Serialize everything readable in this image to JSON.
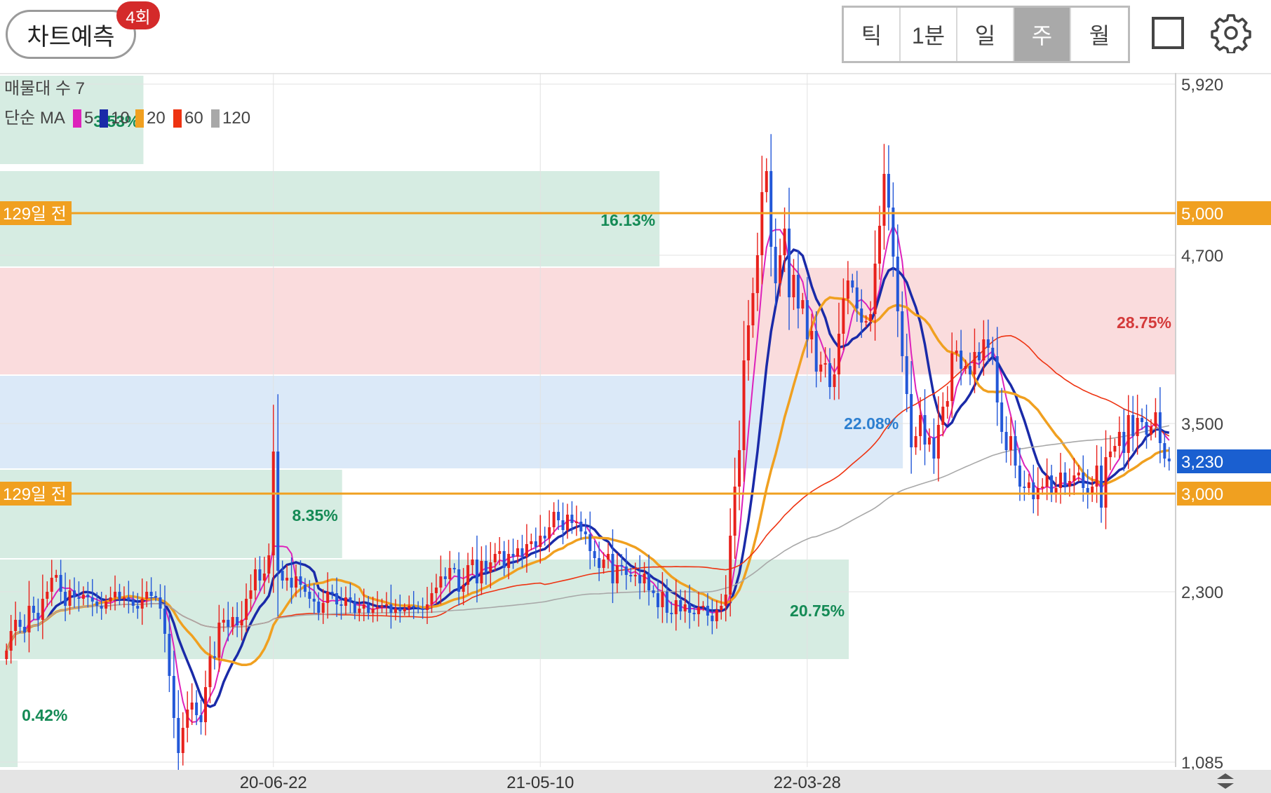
{
  "toolbar": {
    "predict_label": "차트예측",
    "predict_badge": "4회",
    "period_tabs": [
      "틱",
      "1분",
      "일",
      "주",
      "월"
    ],
    "active_tab": "주"
  },
  "legend": {
    "volume_profile_label": "매물대 수 7",
    "ma_label": "단순 MA",
    "ma_periods": [
      "5",
      "10",
      "20",
      "60",
      "120"
    ],
    "ma_colors": [
      "#dd22bb",
      "#1a2aa8",
      "#f0a020",
      "#ee3311",
      "#a8a8a8"
    ]
  },
  "ref_lines": [
    {
      "label": "129일 전",
      "price_label": "5,000",
      "price": 5000
    },
    {
      "label": "129일 전",
      "price_label": "3,000",
      "price": 3000
    }
  ],
  "current_price": {
    "label": "3,230",
    "price": 3230
  },
  "colors": {
    "up": "#e8211c",
    "down": "#2358d8",
    "ref_line": "#f0a020",
    "current_price_bg": "#1a5fd0",
    "zone_green": "#d6ece2",
    "zone_red": "#fadcdd",
    "zone_blue": "#dbe9f8"
  },
  "chart_data": {
    "type": "candlestick",
    "y_ticks": [
      {
        "label": "5,920",
        "value": 5920
      },
      {
        "label": "4,700",
        "value": 4700
      },
      {
        "label": "3,500",
        "value": 3500
      },
      {
        "label": "2,300",
        "value": 2300
      },
      {
        "label": "1,085",
        "value": 1085
      }
    ],
    "ylim": [
      1050,
      5980
    ],
    "x_ticks": [
      {
        "label": "20-06-22",
        "index": 59
      },
      {
        "label": "21-05-10",
        "index": 118
      },
      {
        "label": "22-03-28",
        "index": 177
      }
    ],
    "volume_profile": [
      {
        "low": 5350,
        "high": 5980,
        "pct": "3.53%",
        "color": "green",
        "length": 0.122
      },
      {
        "low": 4620,
        "high": 5300,
        "pct": "16.13%",
        "color": "green",
        "length": 0.561
      },
      {
        "low": 3850,
        "high": 4610,
        "pct": "28.75%",
        "color": "red",
        "length": 1.0
      },
      {
        "low": 3180,
        "high": 3840,
        "pct": "22.08%",
        "color": "blue",
        "length": 0.768
      },
      {
        "low": 2540,
        "high": 3170,
        "pct": "8.35%",
        "color": "green",
        "length": 0.291
      },
      {
        "low": 1820,
        "high": 2530,
        "pct": "20.75%",
        "color": "green",
        "length": 0.722
      },
      {
        "low": 1050,
        "high": 1810,
        "pct": "0.42%",
        "color": "green",
        "length": 0.015
      }
    ],
    "candles": [
      1880,
      2020,
      2100,
      2050,
      2010,
      2200,
      2150,
      2100,
      2250,
      2300,
      2400,
      2420,
      2300,
      2200,
      2310,
      2260,
      2250,
      2280,
      2260,
      2230,
      2200,
      2180,
      2230,
      2260,
      2300,
      2250,
      2260,
      2240,
      2200,
      2180,
      2250,
      2300,
      2270,
      2260,
      2180,
      2000,
      1700,
      1400,
      1150,
      1330,
      1460,
      1510,
      1420,
      1370,
      1620,
      1840,
      1830,
      2080,
      2100,
      2050,
      2120,
      2060,
      2100,
      2250,
      2310,
      2460,
      2380,
      2430,
      2560,
      3300,
      2450,
      2380,
      2400,
      2330,
      2410,
      2350,
      2300,
      2250,
      2230,
      2150,
      2220,
      2300,
      2290,
      2210,
      2200,
      2260,
      2230,
      2150,
      2180,
      2210,
      2150,
      2180,
      2190,
      2200,
      2210,
      2150,
      2180,
      2160,
      2180,
      2200,
      2190,
      2180,
      2170,
      2210,
      2290,
      2330,
      2410,
      2390,
      2470,
      2460,
      2300,
      2350,
      2490,
      2530,
      2360,
      2520,
      2440,
      2510,
      2570,
      2590,
      2470,
      2570,
      2550,
      2610,
      2550,
      2640,
      2660,
      2620,
      2700,
      2680,
      2760,
      2870,
      2810,
      2740,
      2850,
      2790,
      2800,
      2730,
      2710,
      2590,
      2540,
      2470,
      2530,
      2570,
      2360,
      2490,
      2480,
      2420,
      2410,
      2420,
      2360,
      2430,
      2310,
      2290,
      2190,
      2300,
      2150,
      2140,
      2240,
      2160,
      2210,
      2150,
      2140,
      2190,
      2200,
      2130,
      2090,
      2170,
      2200,
      2280,
      2700,
      3050,
      3310,
      3950,
      4200,
      4430,
      4700,
      5150,
      5300,
      4760,
      4500,
      4700,
      4890,
      4400,
      4560,
      4320,
      4380,
      4100,
      4160,
      3870,
      3920,
      3930,
      3760,
      3850,
      4140,
      4390,
      4520,
      4470,
      4320,
      4220,
      4230,
      4280,
      4640,
      4910,
      5280,
      5040,
      4690,
      4300,
      3980,
      3710,
      3330,
      3410,
      3560,
      3350,
      3400,
      3250,
      3490,
      3620,
      3660,
      4000,
      4020,
      3890,
      3910,
      3850,
      4010,
      3950,
      4100,
      4040,
      3980,
      3650,
      3440,
      3310,
      3410,
      3200,
      3050,
      3040,
      3080,
      2960,
      3040,
      3050,
      3130,
      3000,
      3040,
      3150,
      3050,
      3090,
      3130,
      3150,
      3040,
      3000,
      3050,
      3200,
      2900,
      3260,
      3300,
      3340,
      3440,
      3290,
      3560,
      3410,
      3540,
      3510,
      3420,
      3480,
      3580,
      3360,
      3250,
      3230
    ]
  }
}
